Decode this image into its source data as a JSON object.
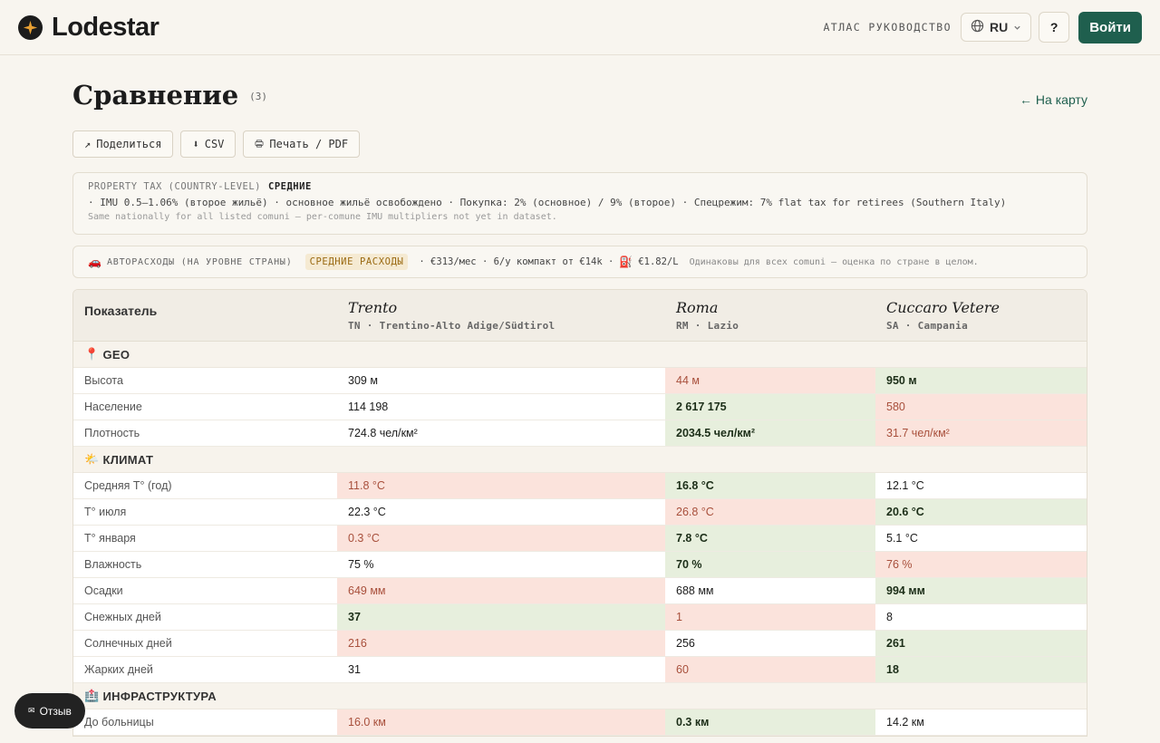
{
  "header": {
    "brand": "Lodestar",
    "nav_guide": "АТЛАС РУКОВОДСТВО",
    "lang": "RU",
    "help": "?",
    "login": "Войти"
  },
  "page": {
    "title": "Сравнение",
    "count": "(3)",
    "back": "← На карту"
  },
  "actions": {
    "share": "Поделиться",
    "csv": "CSV",
    "print": "Печать / PDF"
  },
  "tax": {
    "label": "PROPERTY TAX (COUNTRY-LEVEL)",
    "level": "СРЕДНИЕ",
    "details": "· IMU 0.5–1.06% (второе жильё) · основное жильё освобождено · Покупка: 2% (основное) / 9% (второе) · Спецрежим: 7% flat tax for retirees (Southern Italy)",
    "note": "Same nationally for all listed comuni — per-comune IMU multipliers not yet in dataset."
  },
  "car": {
    "label": "АВТОРАСХОДЫ (НА УРОВНЕ СТРАНЫ)",
    "badge": "СРЕДНИЕ РАСХОДЫ",
    "details": "· €313/мес · 6/у компакт от €14k ·",
    "fuel": "€1.82/L",
    "note": "Одинаковы для всех comuni — оценка по стране в целом."
  },
  "table": {
    "header_label": "Показатель",
    "columns": [
      {
        "city": "Trento",
        "region": "TN · Trentino-Alto Adige/Südtirol"
      },
      {
        "city": "Roma",
        "region": "RM · Lazio"
      },
      {
        "city": "Cuccaro Vetere",
        "region": "SA · Campania"
      }
    ],
    "sections": [
      {
        "icon": "📍",
        "title": "GEO",
        "rows": [
          {
            "label": "Высота",
            "values": [
              "309 м",
              "44 м",
              "950 м"
            ],
            "status": [
              "",
              "bad",
              "good"
            ]
          },
          {
            "label": "Население",
            "values": [
              "114 198",
              "2 617 175",
              "580"
            ],
            "status": [
              "",
              "good",
              "bad"
            ]
          },
          {
            "label": "Плотность",
            "values": [
              "724.8 чел/км²",
              "2034.5 чел/км²",
              "31.7 чел/км²"
            ],
            "status": [
              "",
              "good",
              "bad"
            ]
          }
        ]
      },
      {
        "icon": "🌤️",
        "title": "КЛИМАТ",
        "rows": [
          {
            "label": "Средняя T° (год)",
            "values": [
              "11.8 °C",
              "16.8 °C",
              "12.1 °C"
            ],
            "status": [
              "bad",
              "good",
              ""
            ]
          },
          {
            "label": "T° июля",
            "values": [
              "22.3 °C",
              "26.8 °C",
              "20.6 °C"
            ],
            "status": [
              "",
              "bad",
              "good"
            ]
          },
          {
            "label": "T° января",
            "values": [
              "0.3 °C",
              "7.8 °C",
              "5.1 °C"
            ],
            "status": [
              "bad",
              "good",
              ""
            ]
          },
          {
            "label": "Влажность",
            "values": [
              "75 %",
              "70 %",
              "76 %"
            ],
            "status": [
              "",
              "good",
              "bad"
            ]
          },
          {
            "label": "Осадки",
            "values": [
              "649 мм",
              "688 мм",
              "994 мм"
            ],
            "status": [
              "bad",
              "",
              "good"
            ]
          },
          {
            "label": "Снежных дней",
            "values": [
              "37",
              "1",
              "8"
            ],
            "status": [
              "good",
              "bad",
              ""
            ]
          },
          {
            "label": "Солнечных дней",
            "values": [
              "216",
              "256",
              "261"
            ],
            "status": [
              "bad",
              "",
              "good"
            ]
          },
          {
            "label": "Жарких дней",
            "values": [
              "31",
              "60",
              "18"
            ],
            "status": [
              "",
              "bad",
              "good"
            ]
          }
        ]
      },
      {
        "icon": "🏥",
        "title": "ИНФРАСТРУКТУРА",
        "rows": [
          {
            "label": "До больницы",
            "values": [
              "16.0 км",
              "0.3 км",
              "14.2 км"
            ],
            "status": [
              "bad",
              "good",
              ""
            ]
          }
        ]
      }
    ]
  },
  "feedback": "Отзыв",
  "colors": {
    "accent": "#1f5f4e",
    "good_bg": "#e7efdd",
    "bad_bg": "#fbe3dc",
    "bad_text": "#a8503c"
  }
}
